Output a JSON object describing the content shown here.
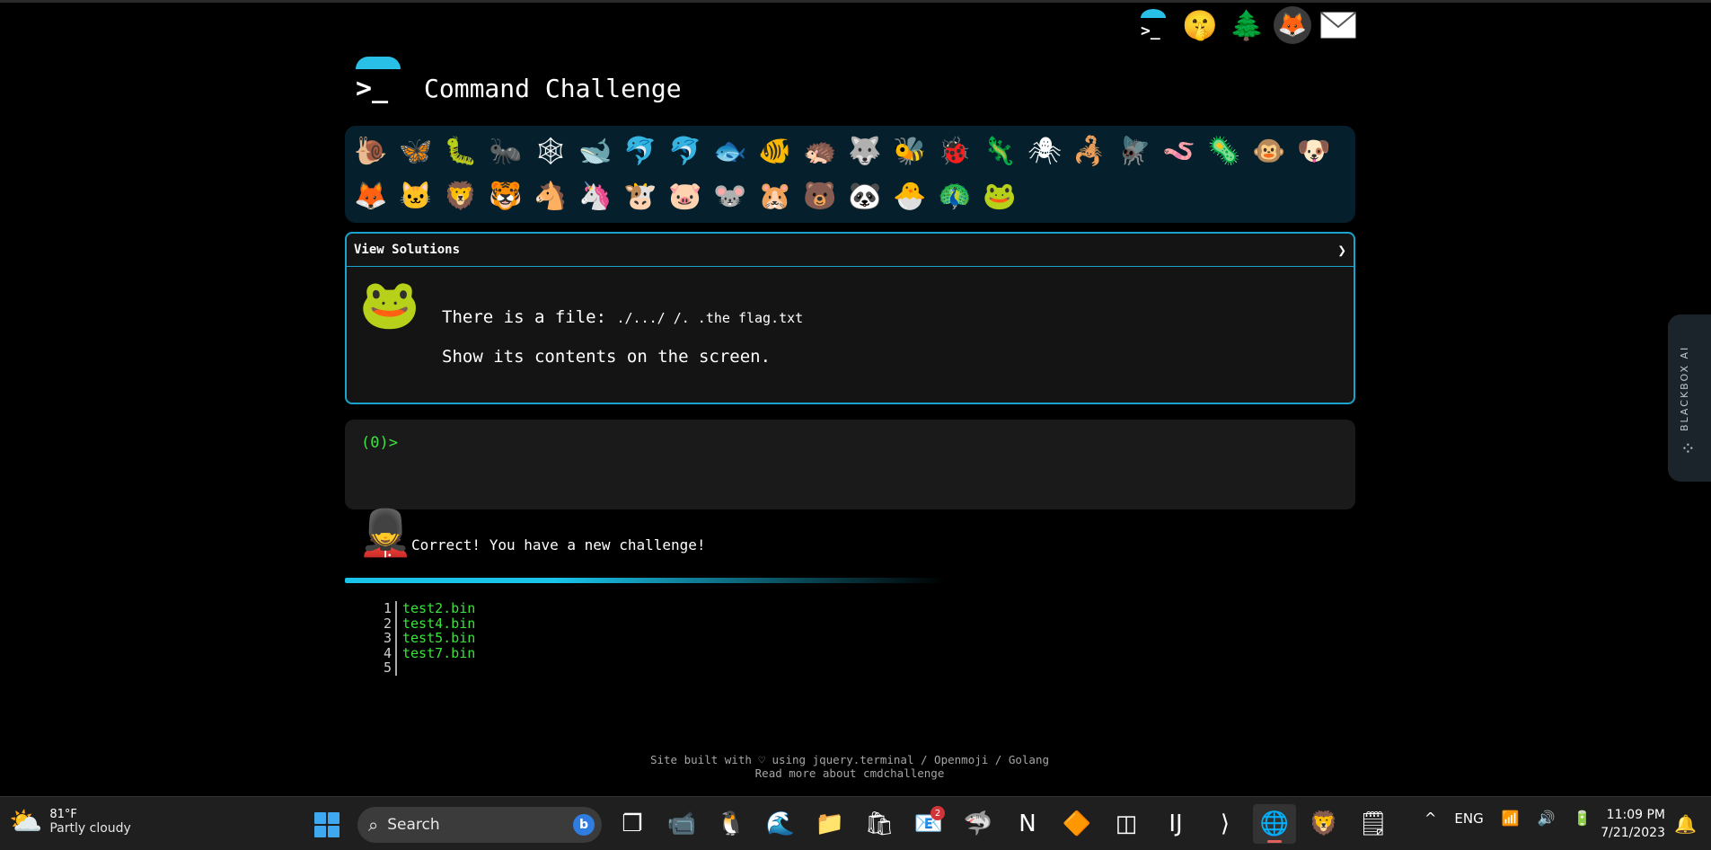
{
  "top_icons": [
    {
      "name": "cmdchallenge-logo-icon",
      "glyph": "⛶"
    },
    {
      "name": "shushing-face-icon",
      "glyph": "🤫"
    },
    {
      "name": "tree-icon",
      "glyph": "🌲"
    },
    {
      "name": "gitlab-icon",
      "glyph": "🦊"
    },
    {
      "name": "mail-icon",
      "glyph": "✉"
    }
  ],
  "header": {
    "logo_prompt": ">_",
    "title": "Command Challenge"
  },
  "animals": [
    "🐌",
    "🦋",
    "🐛",
    "🐜",
    "🕸",
    "🐋",
    "🐬",
    "🐬",
    "🐟",
    "🐠",
    "🦔",
    "🐺",
    "🐝",
    "🐞",
    "🦎",
    "🕷",
    "🦂",
    "🪰",
    "🪱",
    "🦠",
    "🐵",
    "🐶",
    "🦊",
    "🐱",
    "🦁",
    "🐯",
    "🐴",
    "🦄",
    "🐮",
    "🐷",
    "🐭",
    "🐹",
    "🐻",
    "🐼",
    "🐣",
    "🦚",
    "🐸"
  ],
  "challenge": {
    "header_label": "View Solutions",
    "chevron": "❯",
    "avatar": "🐸",
    "line1_prefix": "There is a file:",
    "line1_path": "./.../ /. .the flag.txt",
    "line2": "Show its contents on the screen."
  },
  "terminal": {
    "prompt": "(0)>"
  },
  "feedback": {
    "avatar": "💂",
    "message": "Correct! You have a new challenge!"
  },
  "listing": {
    "rows": [
      {
        "num": "1",
        "name": "test2.bin"
      },
      {
        "num": "2",
        "name": "test4.bin"
      },
      {
        "num": "3",
        "name": "test5.bin"
      },
      {
        "num": "4",
        "name": "test7.bin"
      },
      {
        "num": "5",
        "name": ""
      }
    ]
  },
  "footer": {
    "line1": "Site built with ♡ using jquery.terminal / Openmoji / Golang",
    "line2": "Read more about cmdchallenge"
  },
  "side_tab": {
    "label": "BLACKBOX AI"
  },
  "taskbar": {
    "weather": {
      "temp": "81°F",
      "condition": "Partly cloudy"
    },
    "search_placeholder": "Search",
    "apps": [
      {
        "name": "task-view-icon",
        "glyph": "❐"
      },
      {
        "name": "teams-icon",
        "glyph": "📹"
      },
      {
        "name": "app-icon",
        "glyph": "🐧"
      },
      {
        "name": "edge-icon",
        "glyph": "🌊"
      },
      {
        "name": "file-explorer-icon",
        "glyph": "📁"
      },
      {
        "name": "store-icon",
        "glyph": "🛍"
      },
      {
        "name": "mail-app-icon",
        "glyph": "📧",
        "badge": "2"
      },
      {
        "name": "app-red-icon",
        "glyph": "🦈"
      },
      {
        "name": "notion-icon",
        "glyph": "N"
      },
      {
        "name": "vlc-icon",
        "glyph": "🔶"
      },
      {
        "name": "app-blue-icon",
        "glyph": "◫"
      },
      {
        "name": "intellij-icon",
        "glyph": "IJ"
      },
      {
        "name": "vscode-icon",
        "glyph": "⟩"
      },
      {
        "name": "chrome-icon",
        "glyph": "🌐",
        "active": true
      },
      {
        "name": "brave-icon",
        "glyph": "🦁"
      },
      {
        "name": "sticky-notes-icon",
        "glyph": "🗒"
      }
    ],
    "tray": {
      "chevron": "^",
      "language": "ENG"
    },
    "clock": {
      "time": "11:09 PM",
      "date": "7/21/2023"
    }
  }
}
